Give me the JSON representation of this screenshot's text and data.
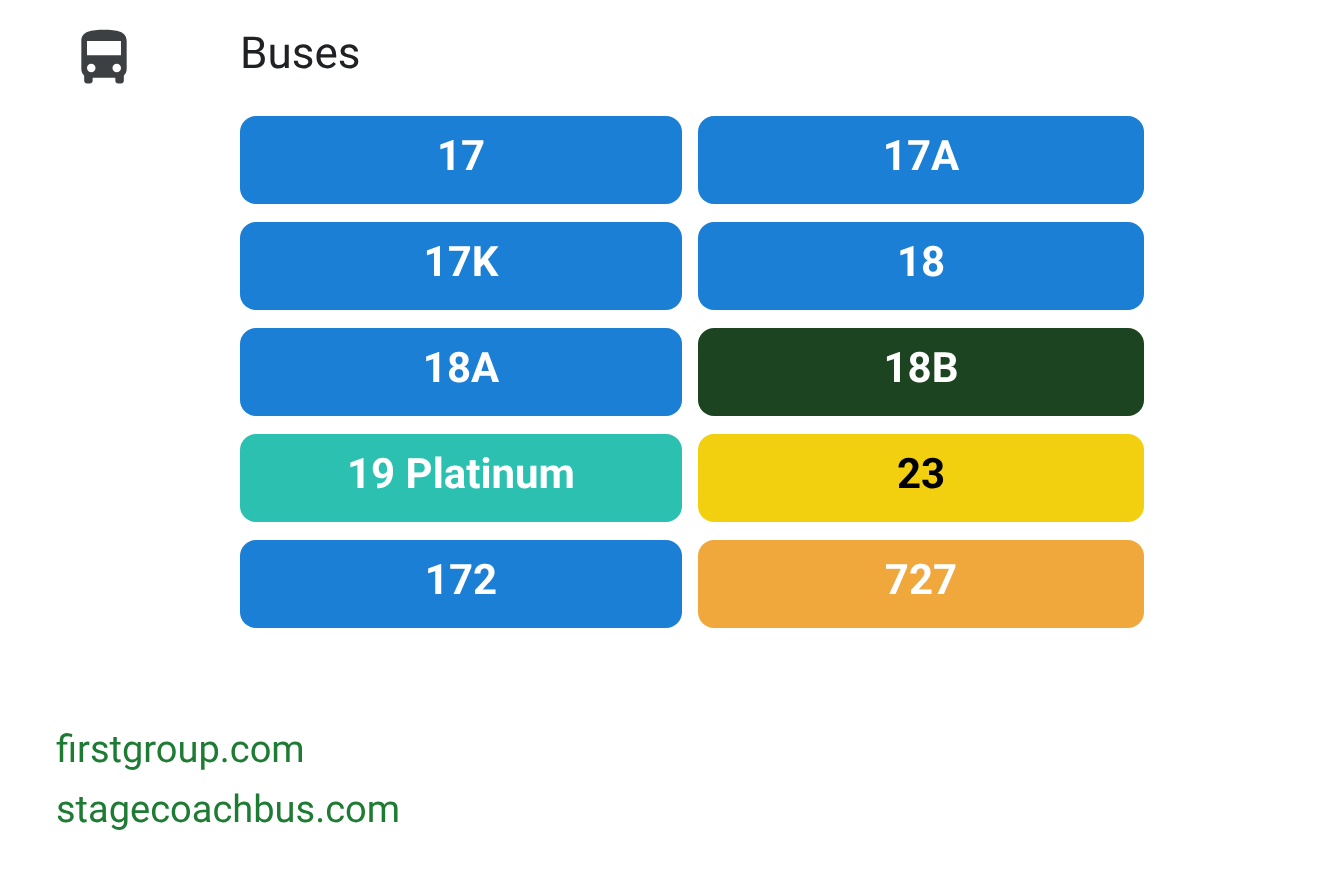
{
  "section": {
    "title": "Buses"
  },
  "routes": [
    {
      "label": "17",
      "color": "#1a7fd5",
      "dark_text": false
    },
    {
      "label": "17A",
      "color": "#1a7fd5",
      "dark_text": false
    },
    {
      "label": "17K",
      "color": "#1a7fd5",
      "dark_text": false
    },
    {
      "label": "18",
      "color": "#1a7fd5",
      "dark_text": false
    },
    {
      "label": "18A",
      "color": "#1a7fd5",
      "dark_text": false
    },
    {
      "label": "18B",
      "color": "#1c4420",
      "dark_text": false
    },
    {
      "label": "19 Platinum",
      "color": "#2cc0b1",
      "dark_text": false
    },
    {
      "label": "23",
      "color": "#f2d00f",
      "dark_text": true
    },
    {
      "label": "172",
      "color": "#1a7fd5",
      "dark_text": false
    },
    {
      "label": "727",
      "color": "#f0a83c",
      "dark_text": false
    }
  ],
  "links": [
    "firstgroup.com",
    "stagecoachbus.com"
  ]
}
